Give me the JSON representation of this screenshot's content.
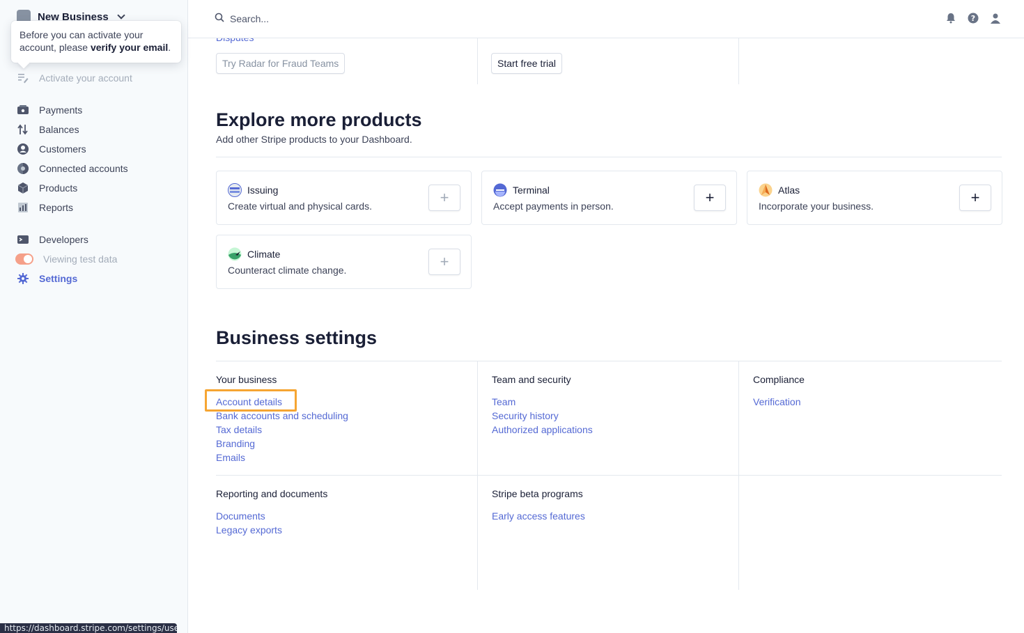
{
  "sidebar": {
    "business_name": "New Business",
    "tooltip_prefix": "Before you can activate your account, please ",
    "tooltip_bold": "verify your email",
    "tooltip_suffix": ".",
    "activate": "Activate your account",
    "items": [
      {
        "label": "Payments",
        "icon": "payments-icon"
      },
      {
        "label": "Balances",
        "icon": "balances-icon"
      },
      {
        "label": "Customers",
        "icon": "customers-icon"
      },
      {
        "label": "Connected accounts",
        "icon": "connected-accounts-icon"
      },
      {
        "label": "Products",
        "icon": "products-icon"
      },
      {
        "label": "Reports",
        "icon": "reports-icon"
      }
    ],
    "developers": "Developers",
    "test_data": "Viewing test data",
    "settings": "Settings"
  },
  "topbar": {
    "search_placeholder": "Search..."
  },
  "top_section": {
    "disputes_link": "Disputes",
    "radar_button": "Try Radar for Fraud Teams",
    "trial_button": "Start free trial"
  },
  "explore": {
    "title": "Explore more products",
    "subtitle": "Add other Stripe products to your Dashboard.",
    "products": [
      {
        "name": "Issuing",
        "desc": "Create virtual and physical cards."
      },
      {
        "name": "Terminal",
        "desc": "Accept payments in person."
      },
      {
        "name": "Atlas",
        "desc": "Incorporate your business."
      },
      {
        "name": "Climate",
        "desc": "Counteract climate change."
      }
    ],
    "add_symbol": "+"
  },
  "business_settings": {
    "title": "Business settings",
    "your_business": {
      "title": "Your business",
      "links": [
        "Account details",
        "Bank accounts and scheduling",
        "Tax details",
        "Branding",
        "Emails"
      ]
    },
    "team_security": {
      "title": "Team and security",
      "links": [
        "Team",
        "Security history",
        "Authorized applications"
      ]
    },
    "compliance": {
      "title": "Compliance",
      "links": [
        "Verification"
      ]
    },
    "reporting": {
      "title": "Reporting and documents",
      "links": [
        "Documents",
        "Legacy exports"
      ]
    },
    "beta": {
      "title": "Stripe beta programs",
      "links": [
        "Early access features"
      ]
    }
  },
  "status_url": "https://dashboard.stripe.com/settings/user",
  "colors": {
    "accent": "#5469d4",
    "highlight": "#f6a532",
    "toggle": "#f5a089"
  }
}
